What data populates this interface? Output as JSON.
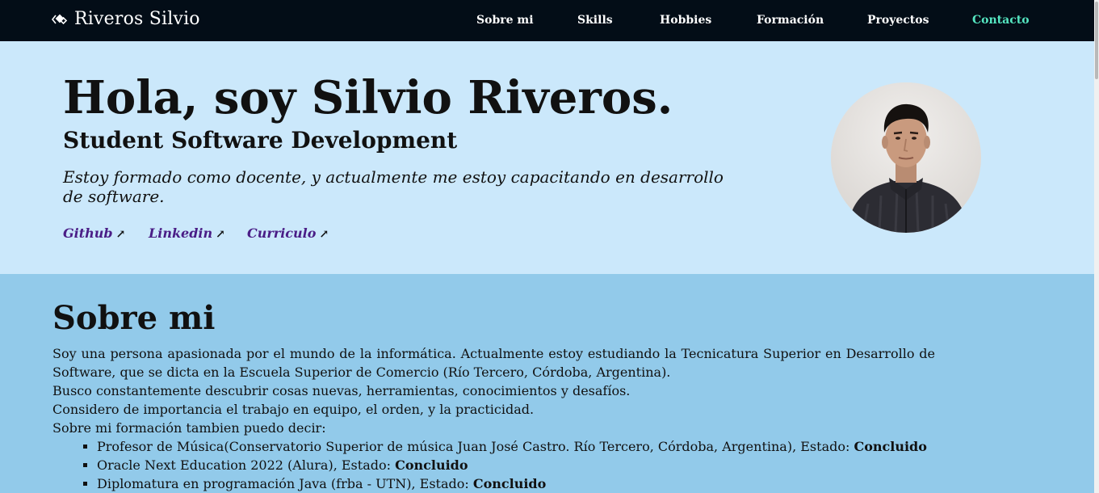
{
  "brand": {
    "name": "Riveros Silvio",
    "icon": "diamond-code-icon"
  },
  "nav": {
    "items": [
      {
        "label": "Sobre mi"
      },
      {
        "label": "Skills"
      },
      {
        "label": "Hobbies"
      },
      {
        "label": "Formación"
      },
      {
        "label": "Proyectos"
      },
      {
        "label": "Contacto",
        "active": true
      }
    ]
  },
  "hero": {
    "title": "Hola, soy Silvio Riveros.",
    "subtitle": "Student Software Development",
    "tagline": "Estoy formado como docente, y actualmente me estoy capacitando en desarrollo de software.",
    "links": [
      {
        "label": "Github",
        "icon": "external-link-icon"
      },
      {
        "label": "Linkedin",
        "icon": "external-link-icon"
      },
      {
        "label": "Curriculo",
        "icon": "external-link-icon"
      }
    ],
    "avatar": "profile-photo"
  },
  "about": {
    "title": "Sobre mi",
    "paragraphs": [
      "Soy una persona apasionada por el mundo de la informática. Actualmente estoy estudiando la Tecnicatura Superior en Desarrollo de Software, que se dicta en la Escuela Superior de Comercio (Río Tercero, Córdoba, Argentina).",
      "Busco constantemente descubrir cosas nuevas, herramientas, conocimientos y desafíos.",
      "Considero de importancia el trabajo en equipo, el orden, y la practicidad.",
      "Sobre mi formación tambien puedo decir:"
    ],
    "education": [
      {
        "text": "Profesor de Música(Conservatorio Superior de música Juan José Castro. Río Tercero, Córdoba, Argentina), Estado: ",
        "status": "Concluido"
      },
      {
        "text": "Oracle Next Education 2022 (Alura), Estado: ",
        "status": "Concluido"
      },
      {
        "text": "Diplomatura en programación Java (frba - UTN), Estado: ",
        "status": "Concluido"
      }
    ]
  },
  "colors": {
    "nav_bg": "#030d17",
    "hero_bg": "#cbe8fb",
    "about_bg": "#92caea",
    "accent": "#55e6c1",
    "link": "#4a1d86"
  }
}
